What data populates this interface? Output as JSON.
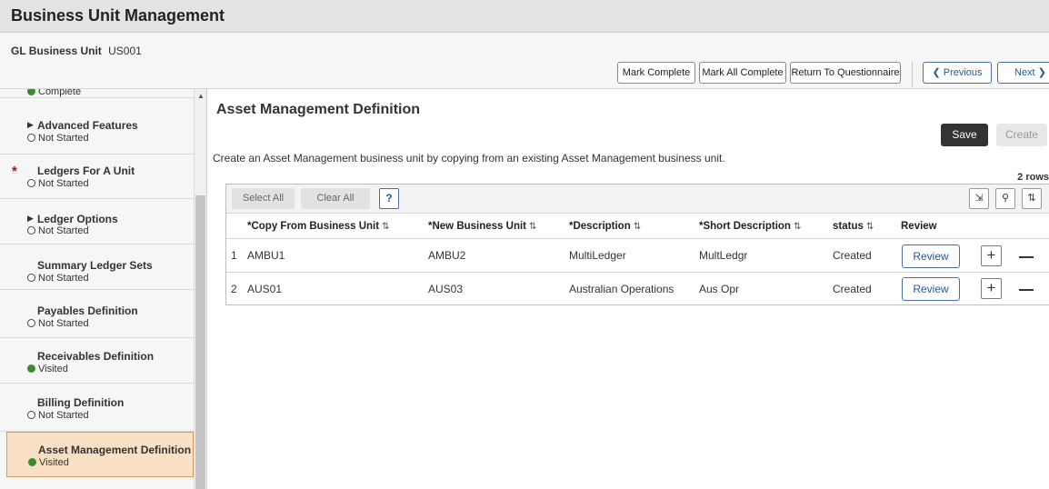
{
  "header": {
    "title": "Business Unit Management"
  },
  "business_unit": {
    "label": "GL Business Unit",
    "value": "US001"
  },
  "toolbar": {
    "mark_complete": "Mark Complete",
    "mark_all_complete": "Mark All Complete",
    "return_questionnaire": "Return To Questionnaire",
    "previous": "Previous",
    "next": "Next"
  },
  "sidebar": {
    "items": [
      {
        "label": "",
        "status": "Complete",
        "status_icon": "check-circle",
        "expandable": false,
        "required": false
      },
      {
        "label": "Advanced Features",
        "status": "Not Started",
        "status_icon": "empty-circle",
        "expandable": true,
        "required": false
      },
      {
        "label": "Ledgers For A Unit",
        "status": "Not Started",
        "status_icon": "empty-circle",
        "expandable": false,
        "required": true
      },
      {
        "label": "Ledger Options",
        "status": "Not Started",
        "status_icon": "empty-circle",
        "expandable": true,
        "required": false
      },
      {
        "label": "Summary Ledger Sets",
        "status": "Not Started",
        "status_icon": "empty-circle",
        "expandable": false,
        "required": false
      },
      {
        "label": "Payables Definition",
        "status": "Not Started",
        "status_icon": "empty-circle",
        "expandable": false,
        "required": false
      },
      {
        "label": "Receivables Definition",
        "status": "Visited",
        "status_icon": "green-dot",
        "expandable": false,
        "required": false
      },
      {
        "label": "Billing Definition",
        "status": "Not Started",
        "status_icon": "empty-circle",
        "expandable": false,
        "required": false
      },
      {
        "label": "Asset Management Definition",
        "status": "Visited",
        "status_icon": "green-dot",
        "expandable": false,
        "required": false,
        "active": true
      }
    ]
  },
  "main": {
    "title": "Asset Management Definition",
    "save_label": "Save",
    "create_label": "Create",
    "description": "Create an Asset Management business unit by copying from an existing Asset Management business unit.",
    "row_count": "2 rows"
  },
  "grid": {
    "select_all": "Select All",
    "clear_all": "Clear All",
    "help": "?",
    "columns": [
      "*Copy From Business Unit",
      "*New Business Unit",
      "*Description",
      "*Short Description",
      "status",
      "Review"
    ],
    "rows": [
      {
        "num": "1",
        "copy_from": "AMBU1",
        "new_bu": "AMBU2",
        "description": "MultiLedger",
        "short_desc": "MultLedgr",
        "status": "Created",
        "review": "Review"
      },
      {
        "num": "2",
        "copy_from": "AUS01",
        "new_bu": "AUS03",
        "description": "Australian Operations",
        "short_desc": "Aus Opr",
        "status": "Created",
        "review": "Review"
      }
    ]
  },
  "colors": {
    "accent": "#2b5797",
    "active_step_bg": "#f9dfc3",
    "save_bg": "#333333",
    "visited_green": "#3c8a2e"
  }
}
